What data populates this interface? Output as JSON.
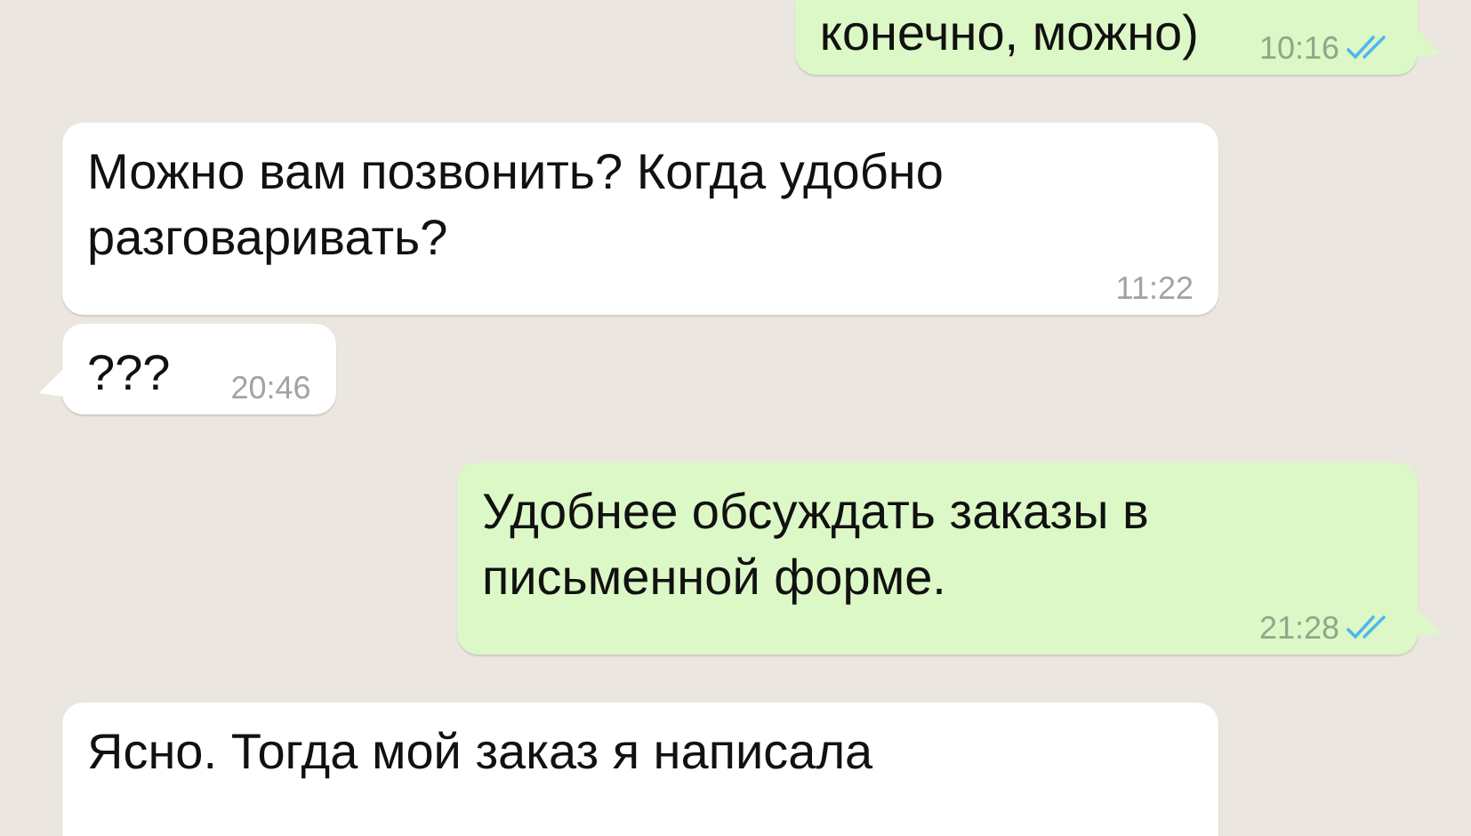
{
  "messages": [
    {
      "kind": "outgoing",
      "text": "конечно, можно)",
      "time": "10:16",
      "read": true,
      "tail": true
    },
    {
      "kind": "incoming",
      "text": "Можно вам позвонить? Когда удобно разговаривать?",
      "time": "11:22",
      "tail": false
    },
    {
      "kind": "incoming",
      "text": "???",
      "time": "20:46",
      "tail": true
    },
    {
      "kind": "outgoing",
      "text": "Удобнее обсуждать заказы в письменной форме.",
      "time": "21:28",
      "read": true,
      "tail": true
    },
    {
      "kind": "incoming",
      "text": "Ясно. Тогда мой заказ я написала"
    }
  ]
}
